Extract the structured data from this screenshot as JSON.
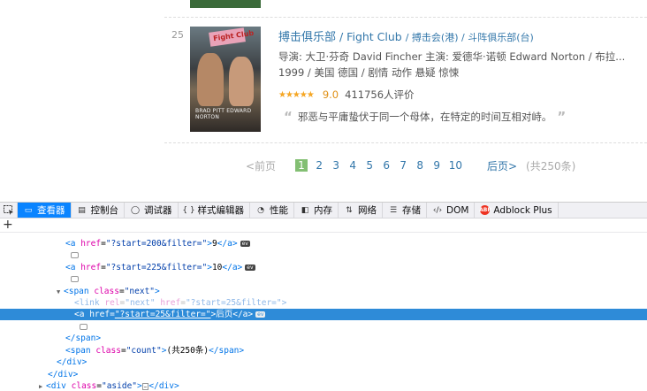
{
  "movie": {
    "rank": "25",
    "title_main": "搏击俱乐部",
    "title_en": "/ Fight Club",
    "title_other": "/ 搏击会(港) / 斗阵俱乐部(台)",
    "crew": "导演: 大卫·芬奇 David Fincher   主演: 爱德华·诺顿 Edward Norton / 布拉...",
    "meta": "1999 / 美国 德国 / 剧情 动作 悬疑 惊悚",
    "stars": "★★★★★",
    "score": "9.0",
    "votes": "411756人评价",
    "quote_open": "“",
    "quote": "邪恶与平庸蛰伏于同一个母体，在特定的时间互相对峙。",
    "quote_close": "”",
    "poster_logo": "Fight Club",
    "poster_names": "BRAD PITT  EDWARD NORTON"
  },
  "pager": {
    "prev": "<前页",
    "current": "1",
    "pages": [
      "2",
      "3",
      "4",
      "5",
      "6",
      "7",
      "8",
      "9",
      "10"
    ],
    "next": "后页>",
    "count": "(共250条)"
  },
  "devtools": {
    "tabs": [
      {
        "label": "查看器",
        "icon": "▭"
      },
      {
        "label": "控制台",
        "icon": "▤"
      },
      {
        "label": "调试器",
        "icon": "◯"
      },
      {
        "label": "样式编辑器",
        "icon": "{ }"
      },
      {
        "label": "性能",
        "icon": "◔"
      },
      {
        "label": "内存",
        "icon": "◧"
      },
      {
        "label": "网络",
        "icon": "⇅"
      },
      {
        "label": "存储",
        "icon": "☰"
      },
      {
        "label": "DOM",
        "icon": "‹/›"
      },
      {
        "label": "Adblock Plus",
        "icon": "ABP"
      }
    ],
    "plus": "+",
    "code": {
      "a_open": "<a",
      "href_attr": "href",
      "eq": "=",
      "gt": ">",
      "start200": "\"?start=200&filter=\"",
      "page9": "9",
      "a_close": "</a>",
      "start225": "\"?start=225&filter=\"",
      "page10": "10",
      "span_open": "<span",
      "class_attr": "class",
      "next_val": "\"next\"",
      "link_open": "<link",
      "rel_attr": "rel",
      "rel_val": "\"next\"",
      "start25": "\"?start=25&filter=\"",
      "link_tail": ">",
      "next_text": "后页",
      "span_close": "</span>",
      "count_val": "\"count\"",
      "count_text": "(共250条)",
      "div_close": "</div>",
      "div_open": "<div",
      "aside_val": "\"aside\"",
      "ev": "ev",
      "dots": "…"
    }
  }
}
